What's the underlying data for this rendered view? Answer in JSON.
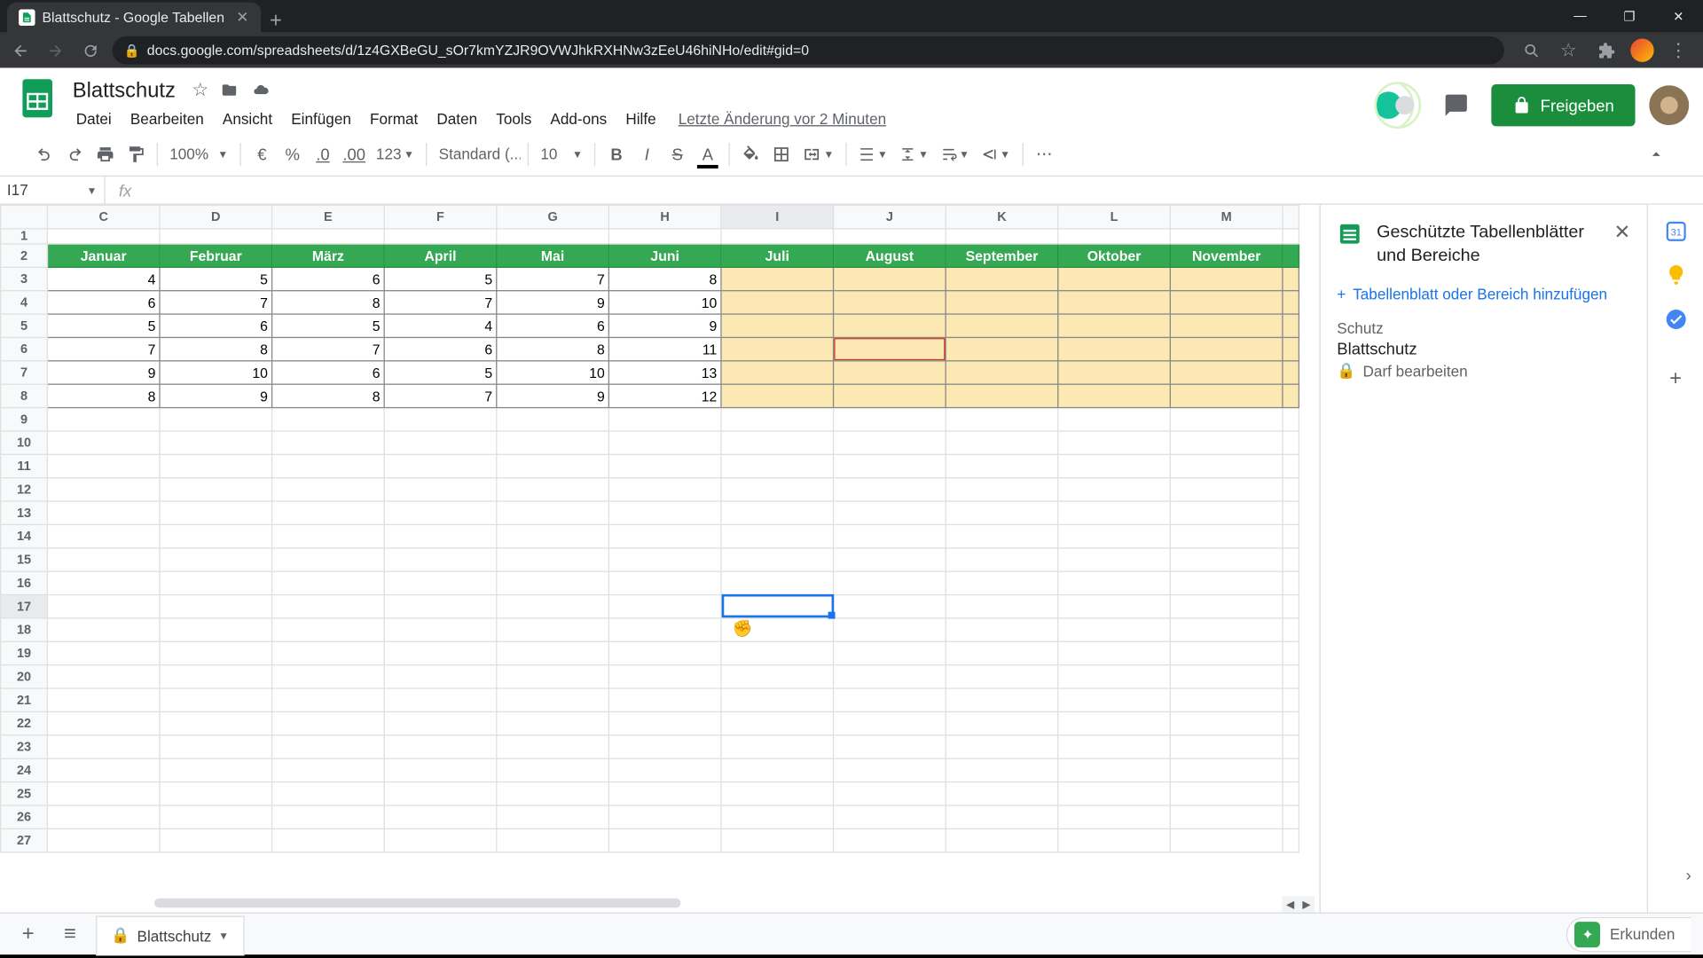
{
  "browser": {
    "tab_title": "Blattschutz - Google Tabellen",
    "url": "docs.google.com/spreadsheets/d/1z4GXBeGU_sOr7kmYZJR9OVWJhkRXHNw3zEeU46hiNHo/edit#gid=0"
  },
  "doc": {
    "title": "Blattschutz"
  },
  "menu": {
    "file": "Datei",
    "edit": "Bearbeiten",
    "view": "Ansicht",
    "insert": "Einfügen",
    "format": "Format",
    "data": "Daten",
    "tools": "Tools",
    "addons": "Add-ons",
    "help": "Hilfe",
    "last_edit": "Letzte Änderung vor 2 Minuten"
  },
  "share": {
    "label": "Freigeben"
  },
  "toolbar": {
    "zoom": "100%",
    "currency": "€",
    "percent": "%",
    "dec_dec": ".0",
    "inc_dec": ".00",
    "more_formats": "123",
    "font_style": "Standard (...",
    "font_size": "10"
  },
  "name_box": "I17",
  "grid": {
    "columns": [
      "C",
      "D",
      "E",
      "F",
      "G",
      "H",
      "I",
      "J",
      "K",
      "L",
      "M"
    ],
    "months": [
      "Januar",
      "Februar",
      "März",
      "April",
      "Mai",
      "Juni",
      "Juli",
      "August",
      "September",
      "Oktober",
      "November"
    ],
    "row_numbers": [
      "1",
      "2",
      "3",
      "4",
      "5",
      "6",
      "7",
      "8",
      "9",
      "10",
      "11",
      "12",
      "13",
      "14",
      "15",
      "16",
      "17",
      "18",
      "19",
      "20",
      "21",
      "22",
      "23",
      "24",
      "25",
      "26",
      "27"
    ],
    "data": [
      [
        "4",
        "5",
        "6",
        "5",
        "7",
        "8"
      ],
      [
        "6",
        "7",
        "8",
        "7",
        "9",
        "10"
      ],
      [
        "5",
        "6",
        "5",
        "4",
        "6",
        "9"
      ],
      [
        "7",
        "8",
        "7",
        "6",
        "8",
        "11"
      ],
      [
        "9",
        "10",
        "6",
        "5",
        "10",
        "13"
      ],
      [
        "8",
        "9",
        "8",
        "7",
        "9",
        "12"
      ]
    ]
  },
  "side_panel": {
    "title": "Geschützte Tabellenblätter und Bereiche",
    "add": "Tabellenblatt oder Bereich hinzufügen",
    "item_label": "Schutz",
    "item_name": "Blattschutz",
    "permission": "Darf bearbeiten"
  },
  "sheet_tabs": {
    "tab1": "Blattschutz"
  },
  "explore": {
    "label": "Erkunden"
  }
}
